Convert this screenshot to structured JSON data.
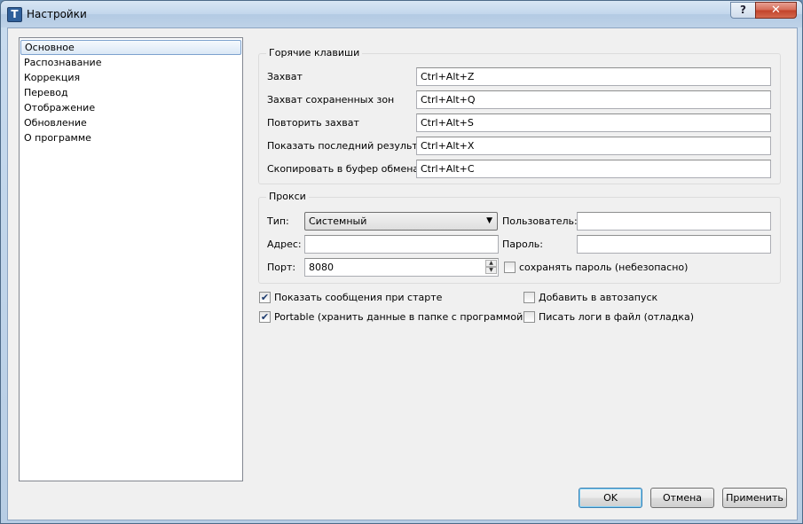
{
  "window": {
    "title": "Настройки",
    "help_glyph": "?",
    "close_glyph": "✕",
    "icon_glyph": "T"
  },
  "nav": {
    "items": [
      {
        "label": "Основное",
        "selected": true
      },
      {
        "label": "Распознавание"
      },
      {
        "label": "Коррекция"
      },
      {
        "label": "Перевод"
      },
      {
        "label": "Отображение"
      },
      {
        "label": "Обновление"
      },
      {
        "label": "О программе"
      }
    ]
  },
  "hotkeys": {
    "title": "Горячие клавиши",
    "rows": [
      {
        "label": "Захват",
        "value": "Ctrl+Alt+Z"
      },
      {
        "label": "Захват сохраненных зон",
        "value": "Ctrl+Alt+Q"
      },
      {
        "label": "Повторить захват",
        "value": "Ctrl+Alt+S"
      },
      {
        "label": "Показать последний результат",
        "value": "Ctrl+Alt+X"
      },
      {
        "label": "Скопировать в буфер обмена",
        "value": "Ctrl+Alt+C"
      }
    ]
  },
  "proxy": {
    "title": "Прокси",
    "type_label": "Тип:",
    "type_value": "Системный",
    "address_label": "Адрес:",
    "address_value": "",
    "port_label": "Порт:",
    "port_value": "8080",
    "user_label": "Пользователь:",
    "user_value": "",
    "password_label": "Пароль:",
    "password_value": "",
    "save_password_label": "сохранять пароль (небезопасно)",
    "save_password_checked": false
  },
  "options": {
    "show_messages": {
      "label": "Показать сообщения при старте",
      "checked": true
    },
    "portable": {
      "label": "Portable (хранить данные в папке с программой)",
      "checked": true
    },
    "autostart": {
      "label": "Добавить в автозапуск",
      "checked": false
    },
    "write_logs": {
      "label": "Писать логи в файл (отладка)",
      "checked": false
    }
  },
  "buttons": {
    "ok": "OK",
    "cancel": "Отмена",
    "apply": "Применить"
  },
  "glyphs": {
    "check": "✔",
    "combo_arrow": "▼",
    "spin_up": "▲",
    "spin_down": "▼"
  }
}
